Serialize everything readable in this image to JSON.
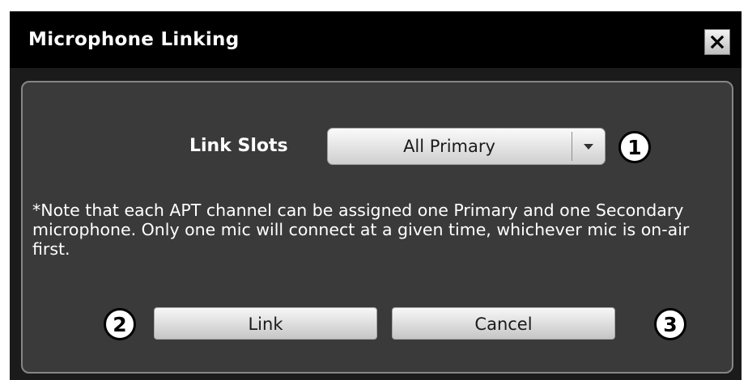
{
  "dialog": {
    "title": "Microphone Linking",
    "close_label": "close"
  },
  "link_slots": {
    "label": "Link Slots",
    "selected": "All Primary"
  },
  "note": "*Note that each APT channel can be assigned one Primary and one Secondary microphone. Only one mic will connect at a given time, whichever mic is on-air first.",
  "buttons": {
    "link": "Link",
    "cancel": "Cancel"
  },
  "callouts": [
    "1",
    "2",
    "3"
  ],
  "colors": {
    "titlebar": "#000000",
    "panel": "#3a3a3a",
    "panel_border": "#868686",
    "text": "#ffffff",
    "button": "#dedede"
  },
  "icons": {
    "close": "close-x-icon",
    "dropdown": "chevron-down-icon"
  }
}
